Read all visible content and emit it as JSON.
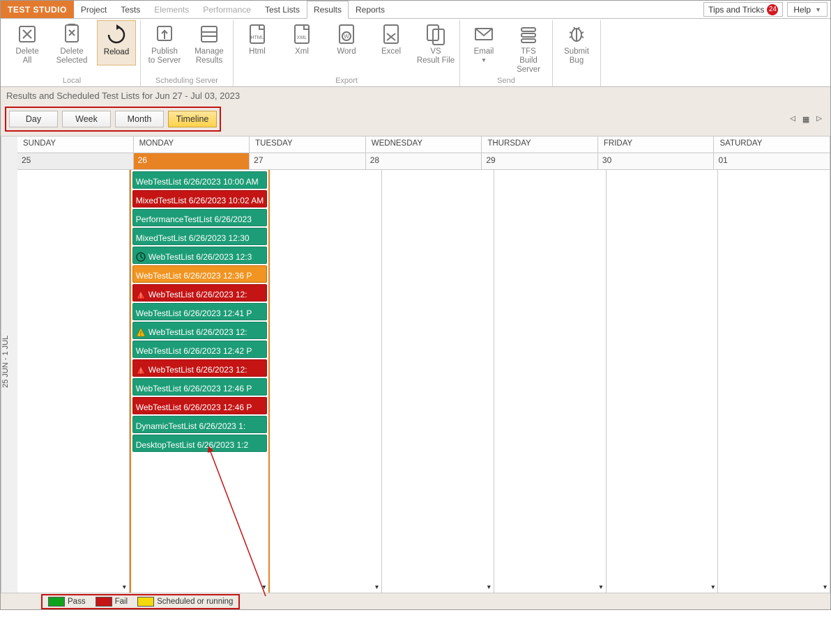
{
  "brand": "TEST STUDIO",
  "menus": [
    "Project",
    "Tests",
    "Elements",
    "Performance",
    "Test Lists",
    "Results",
    "Reports"
  ],
  "menus_disabled": [
    2,
    3
  ],
  "menus_active": 5,
  "tips": "Tips and Tricks",
  "tips_badge": "24",
  "help": "Help",
  "ribbon": {
    "groups": [
      {
        "caption": "Local",
        "items": [
          {
            "icon": "delete-all",
            "label": "Delete\nAll"
          },
          {
            "icon": "delete-selected",
            "label": "Delete\nSelected"
          },
          {
            "icon": "reload",
            "label": "Reload",
            "highlight": true
          }
        ]
      },
      {
        "caption": "Scheduling Server",
        "items": [
          {
            "icon": "publish",
            "label": "Publish\nto Server"
          },
          {
            "icon": "manage",
            "label": "Manage\nResults"
          }
        ]
      },
      {
        "caption": "Export",
        "items": [
          {
            "icon": "html",
            "label": "Html"
          },
          {
            "icon": "xml",
            "label": "Xml"
          },
          {
            "icon": "word",
            "label": "Word"
          },
          {
            "icon": "excel",
            "label": "Excel"
          },
          {
            "icon": "vs",
            "label": "VS\nResult File"
          }
        ]
      },
      {
        "caption": "Send",
        "items": [
          {
            "icon": "email",
            "label": "Email",
            "dropdown": true
          },
          {
            "icon": "tfs",
            "label": "TFS\nBuild Server"
          }
        ]
      },
      {
        "caption": "",
        "items": [
          {
            "icon": "bug",
            "label": "Submit\nBug"
          }
        ]
      }
    ]
  },
  "subheader": "Results and Scheduled Test Lists for Jun 27 - Jul 03, 2023",
  "views": [
    "Day",
    "Week",
    "Month",
    "Timeline"
  ],
  "views_active": 3,
  "sidelabel": "25 JUN - 1 JUL",
  "dayheaders": [
    "SUNDAY",
    "MONDAY",
    "TUESDAY",
    "WEDNESDAY",
    "THURSDAY",
    "FRIDAY",
    "SATURDAY"
  ],
  "dates": [
    "25",
    "26",
    "27",
    "28",
    "29",
    "30",
    "01"
  ],
  "active_date_index": 1,
  "events": [
    {
      "status": "green",
      "icon": "",
      "text": "WebTestList 6/26/2023 10:00 AM"
    },
    {
      "status": "red",
      "icon": "",
      "text": "MixedTestList 6/26/2023 10:02 AM"
    },
    {
      "status": "green",
      "icon": "",
      "text": "PerformanceTestList 6/26/2023"
    },
    {
      "status": "green",
      "icon": "",
      "text": "MixedTestList 6/26/2023 12:30"
    },
    {
      "status": "green",
      "icon": "clock",
      "text": "WebTestList 6/26/2023 12:3"
    },
    {
      "status": "orange",
      "icon": "",
      "text": "WebTestList 6/26/2023 12:36 P"
    },
    {
      "status": "red",
      "icon": "warn",
      "text": "WebTestList 6/26/2023 12:"
    },
    {
      "status": "green",
      "icon": "",
      "text": "WebTestList 6/26/2023 12:41 P"
    },
    {
      "status": "green",
      "icon": "warn-y",
      "text": "WebTestList 6/26/2023 12:"
    },
    {
      "status": "green",
      "icon": "",
      "text": "WebTestList 6/26/2023 12:42 P"
    },
    {
      "status": "red",
      "icon": "warn",
      "text": "WebTestList 6/26/2023 12:"
    },
    {
      "status": "green",
      "icon": "",
      "text": "WebTestList 6/26/2023 12:46 P"
    },
    {
      "status": "red",
      "icon": "",
      "text": "WebTestList 6/26/2023 12:46 P"
    },
    {
      "status": "green",
      "icon": "",
      "text": "DynamicTestList 6/26/2023 1:"
    },
    {
      "status": "green",
      "icon": "",
      "text": "DesktopTestList 6/26/2023 1:2"
    }
  ],
  "legend": [
    {
      "color": "green",
      "label": "Pass"
    },
    {
      "color": "red",
      "label": "Fail"
    },
    {
      "color": "yellow",
      "label": "Scheduled or running"
    }
  ]
}
